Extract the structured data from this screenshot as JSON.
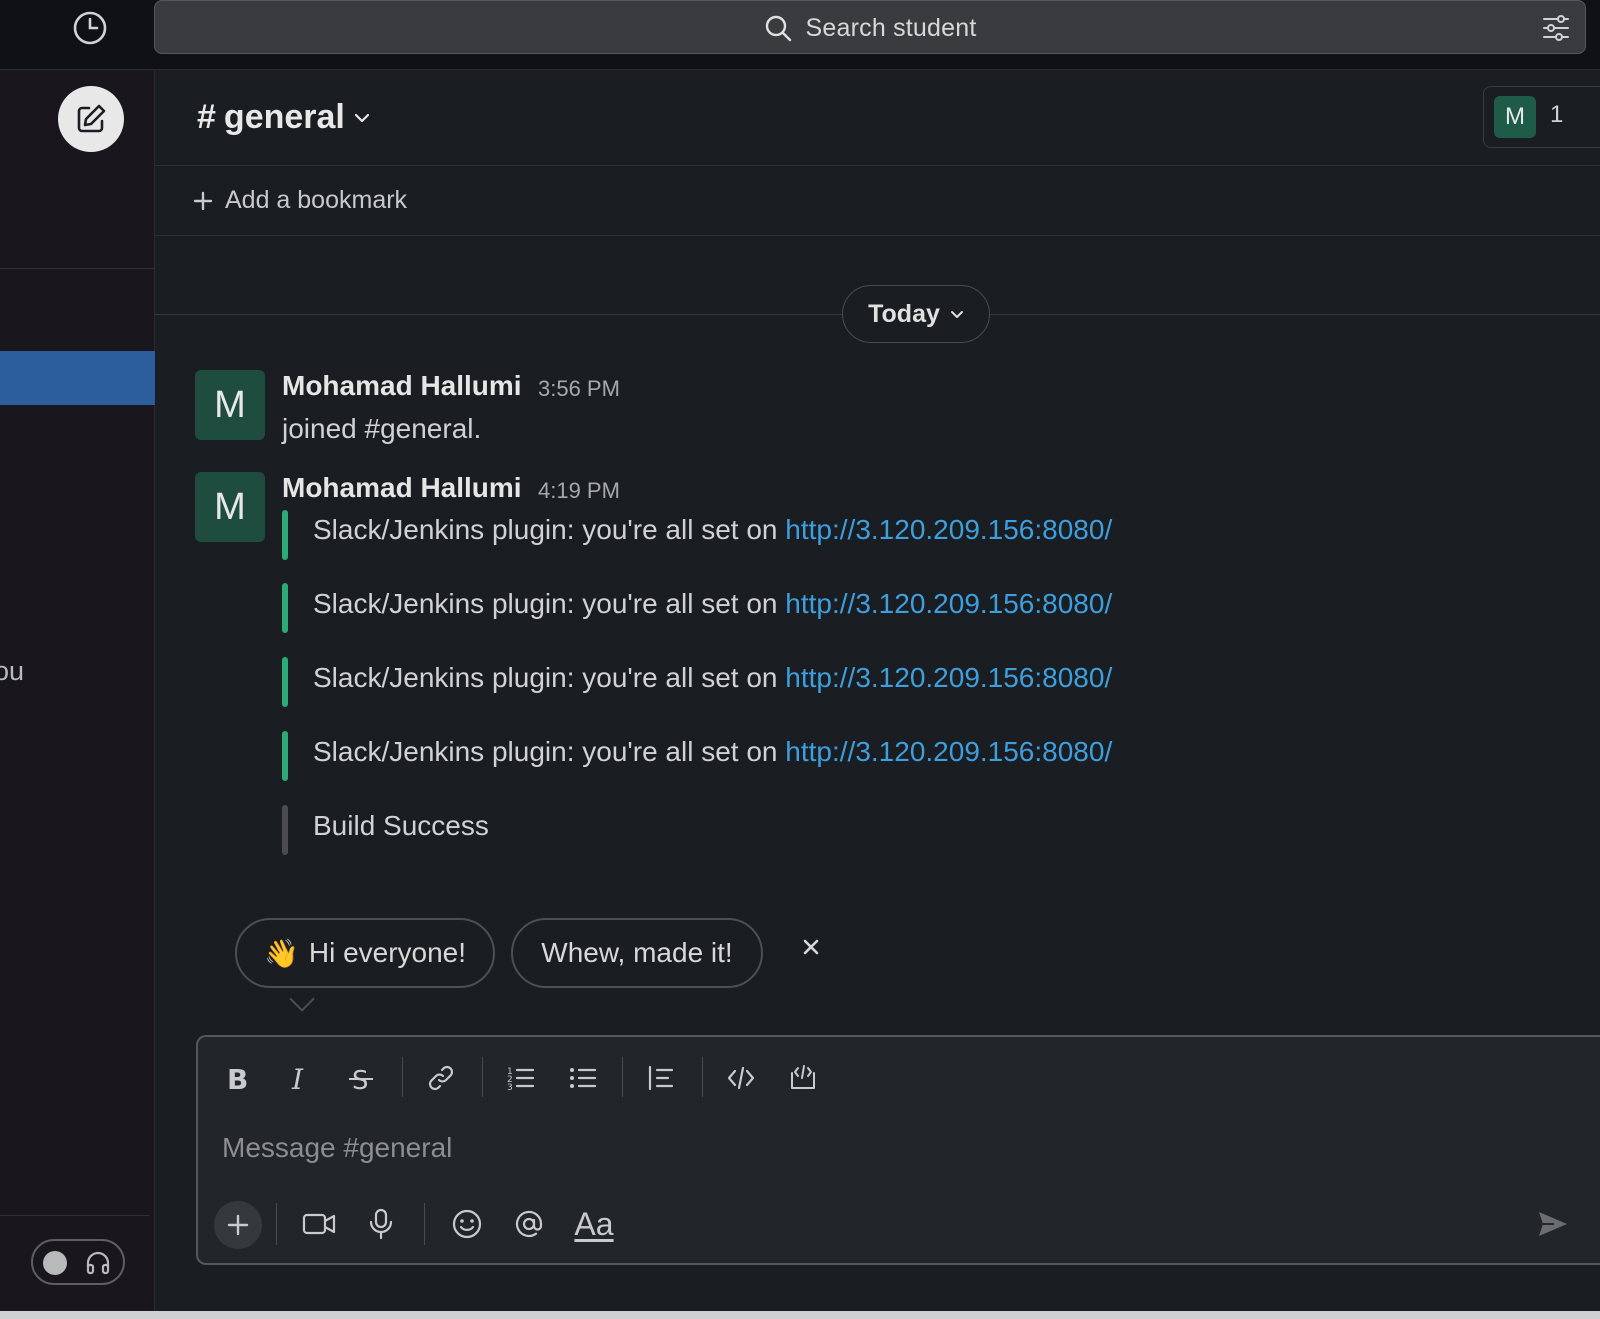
{
  "search": {
    "placeholder": "Search student"
  },
  "channel": {
    "name": "general",
    "hash": "#"
  },
  "members": {
    "avatar_letter": "M",
    "count": "1"
  },
  "bookmark": {
    "label": "Add a bookmark"
  },
  "day_divider": {
    "label": "Today"
  },
  "sidebar": {
    "partial_text": "ou"
  },
  "messages": [
    {
      "avatar_letter": "M",
      "author": "Mohamad Hallumi",
      "time": "3:56 PM",
      "text": "joined #general."
    },
    {
      "avatar_letter": "M",
      "author": "Mohamad Hallumi",
      "time": "4:19 PM",
      "attachments": [
        {
          "text": "Slack/Jenkins plugin: you're all set on ",
          "link": "http://3.120.209.156:8080/"
        },
        {
          "text": "Slack/Jenkins plugin: you're all set on ",
          "link": "http://3.120.209.156:8080/"
        },
        {
          "text": "Slack/Jenkins plugin: you're all set on ",
          "link": "http://3.120.209.156:8080/"
        },
        {
          "text": "Slack/Jenkins plugin: you're all set on ",
          "link": "http://3.120.209.156:8080/"
        },
        {
          "text": "Build Success",
          "link": ""
        }
      ]
    }
  ],
  "suggestions": [
    {
      "emoji": "👋",
      "label": "Hi everyone!"
    },
    {
      "emoji": "",
      "label": "Whew, made it!"
    }
  ],
  "composer": {
    "placeholder": "Message #general",
    "format_tools": [
      "bold-icon",
      "italic-icon",
      "strikethrough-icon",
      "link-icon",
      "ordered-list-icon",
      "bullet-list-icon",
      "blockquote-icon",
      "code-icon",
      "code-block-icon"
    ],
    "bottom_tools": [
      "plus-icon",
      "video-icon",
      "microphone-icon",
      "emoji-icon",
      "mention-icon",
      "text-format-icon",
      "send-icon"
    ],
    "text_format_label": "Aa"
  },
  "colors": {
    "background": "#1a1d21",
    "sidebar_selected": "#2c5e9e",
    "avatar": "#1e4d3f",
    "link": "#3d9fdd",
    "attachment_bar": "#2bac76"
  }
}
